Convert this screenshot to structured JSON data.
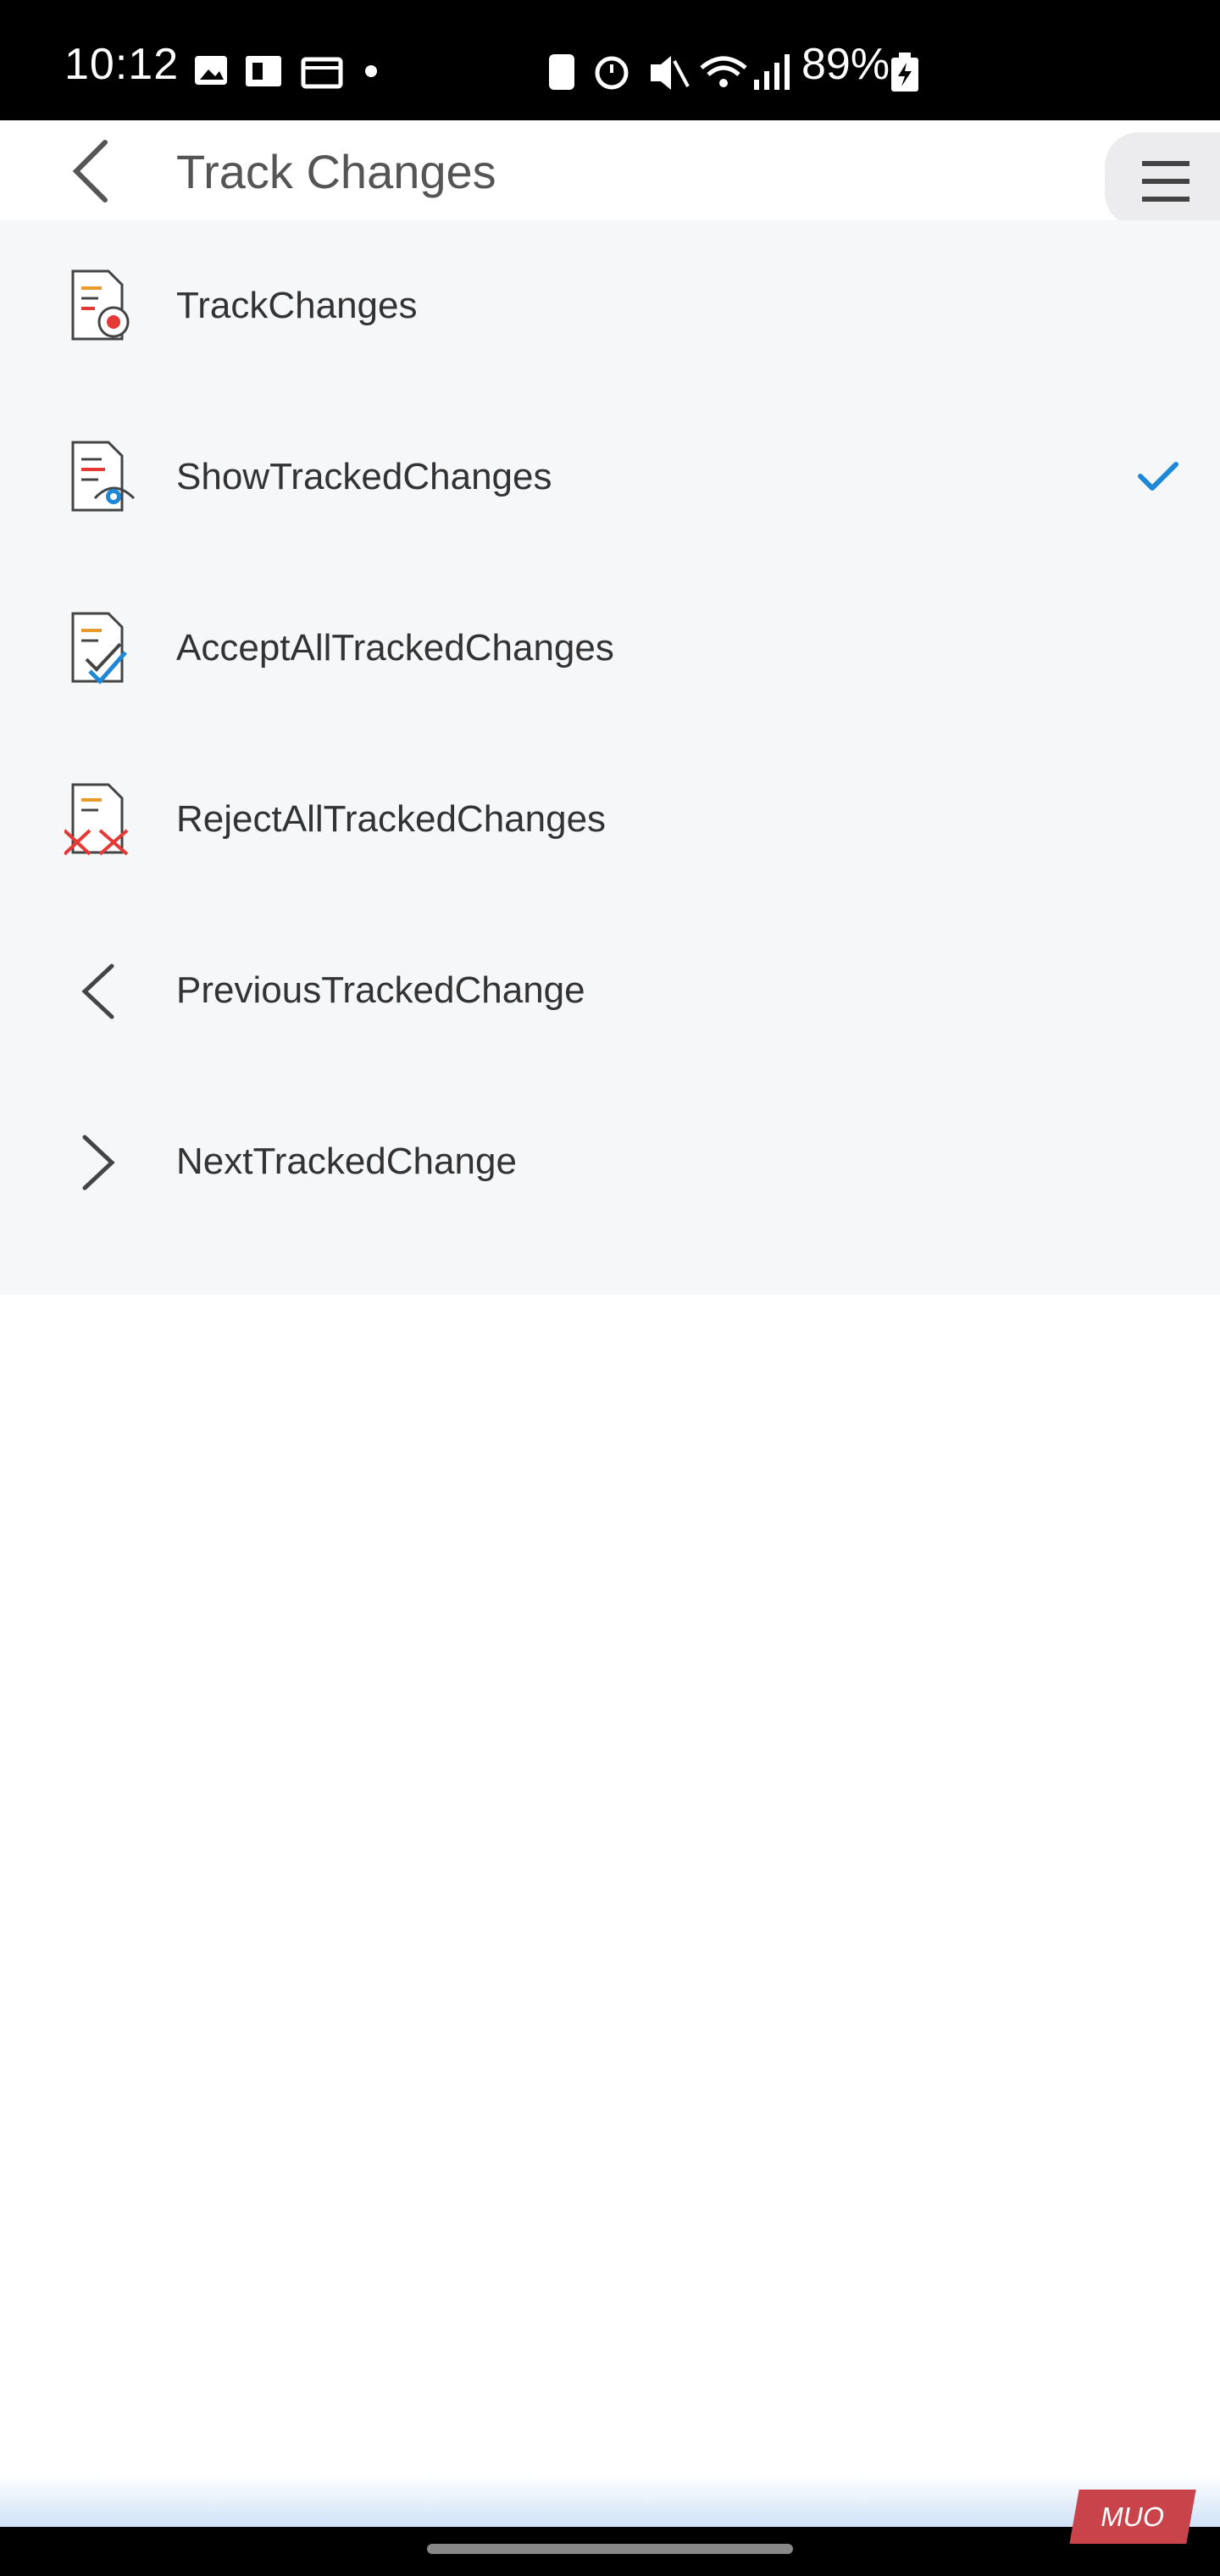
{
  "status_bar": {
    "time": "10:12",
    "battery": "89%"
  },
  "header": {
    "title": "Track Changes",
    "back_icon": "chevron-left-icon",
    "menu_icon": "hamburger-menu-icon"
  },
  "menu": {
    "items": [
      {
        "label": "TrackChanges",
        "icon": "track-changes-icon",
        "checked": false
      },
      {
        "label": "ShowTrackedChanges",
        "icon": "show-tracked-changes-icon",
        "checked": true
      },
      {
        "label": "AcceptAllTrackedChanges",
        "icon": "accept-all-icon",
        "checked": false
      },
      {
        "label": "RejectAllTrackedChanges",
        "icon": "reject-all-icon",
        "checked": false
      },
      {
        "label": "PreviousTrackedChange",
        "icon": "chevron-left-icon",
        "checked": false
      },
      {
        "label": "NextTrackedChange",
        "icon": "chevron-right-icon",
        "checked": false
      }
    ]
  },
  "watermark": {
    "text": "MUO"
  },
  "colors": {
    "accent": "#1e88d6",
    "record_red": "#e53935",
    "panel_bg": "#f6f7f9",
    "text": "#333333"
  }
}
